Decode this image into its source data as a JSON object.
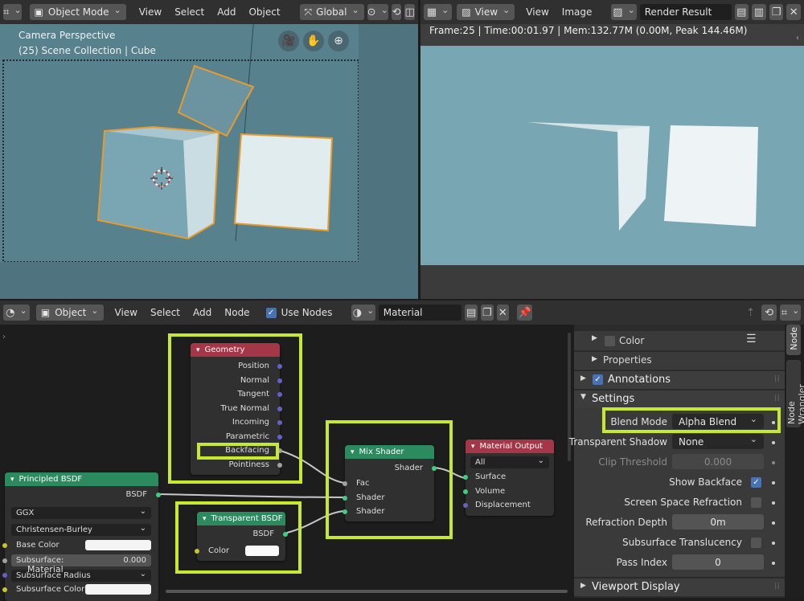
{
  "viewport": {
    "header": {
      "mode": "Object Mode",
      "menus": [
        "View",
        "Select",
        "Add",
        "Object"
      ],
      "transform_orientation": "Global"
    },
    "overlay": {
      "camera_label": "Camera Perspective",
      "collection_label": "(25) Scene Collection | Cube"
    },
    "icons": [
      "editor-type-icon",
      "object-mode-icon",
      "pivot-icon",
      "snap-icon",
      "camera-icon",
      "hand-icon",
      "zoom-icon"
    ]
  },
  "image_editor": {
    "header": {
      "view_menu_1": "View",
      "view_menu_2": "View",
      "image_menu": "Image",
      "image_name": "Render Result"
    },
    "info": "Frame:25 | Time:00:01.97 | Mem:132.77M (0.00M, Peak 144.46M)"
  },
  "node_editor": {
    "header": {
      "type": "Object",
      "menus": [
        "View",
        "Select",
        "Add",
        "Node"
      ],
      "use_nodes_label": "Use Nodes",
      "material_name": "Material"
    },
    "footer_label": "Material",
    "nodes": {
      "geometry": {
        "title": "Geometry",
        "outputs": [
          "Position",
          "Normal",
          "Tangent",
          "True Normal",
          "Incoming",
          "Parametric",
          "Backfacing",
          "Pointiness"
        ]
      },
      "mix_shader": {
        "title": "Mix Shader",
        "output": "Shader",
        "inputs": [
          "Fac",
          "Shader",
          "Shader"
        ]
      },
      "material_output": {
        "title": "Material Output",
        "target": "All",
        "inputs": [
          "Surface",
          "Volume",
          "Displacement"
        ]
      },
      "principled": {
        "title": "Principled BSDF",
        "output": "BSDF",
        "distribution": "GGX",
        "subsurface_method": "Christensen-Burley",
        "base_color_label": "Base Color",
        "subsurface_label": "Subsurface:",
        "subsurface_value": "0.000",
        "subsurface_radius_label": "Subsurface Radius",
        "subsurface_color_label": "Subsurface Color"
      },
      "transparent": {
        "title": "Transparent BSDF",
        "output": "BSDF",
        "color_label": "Color"
      }
    }
  },
  "sidebar": {
    "tabs": [
      "Node",
      "Node Wrangler"
    ],
    "color_label": "Color",
    "properties_label": "Properties",
    "annotations_label": "Annotations",
    "settings_label": "Settings",
    "viewport_display_label": "Viewport Display",
    "settings": {
      "blend_mode_label": "Blend Mode",
      "blend_mode_value": "Alpha Blend",
      "transparent_shadow_label": "Transparent Shadow",
      "transparent_shadow_value": "None",
      "clip_threshold_label": "Clip Threshold",
      "clip_threshold_value": "0.000",
      "show_backface_label": "Show Backface",
      "screen_space_refraction_label": "Screen Space Refraction",
      "refraction_depth_label": "Refraction Depth",
      "refraction_depth_value": "0m",
      "subsurface_translucency_label": "Subsurface Translucency",
      "pass_index_label": "Pass Index",
      "pass_index_value": "0"
    }
  },
  "colors": {
    "highlight": "#c6e92f",
    "selection_outline": "#e89b2d",
    "viewport_bg": "#58818e",
    "render_bg": "#79a6b3",
    "node_geometry_header": "#a33747",
    "node_shader_header": "#2b8a5e",
    "checkbox_on": "#4772b3"
  }
}
